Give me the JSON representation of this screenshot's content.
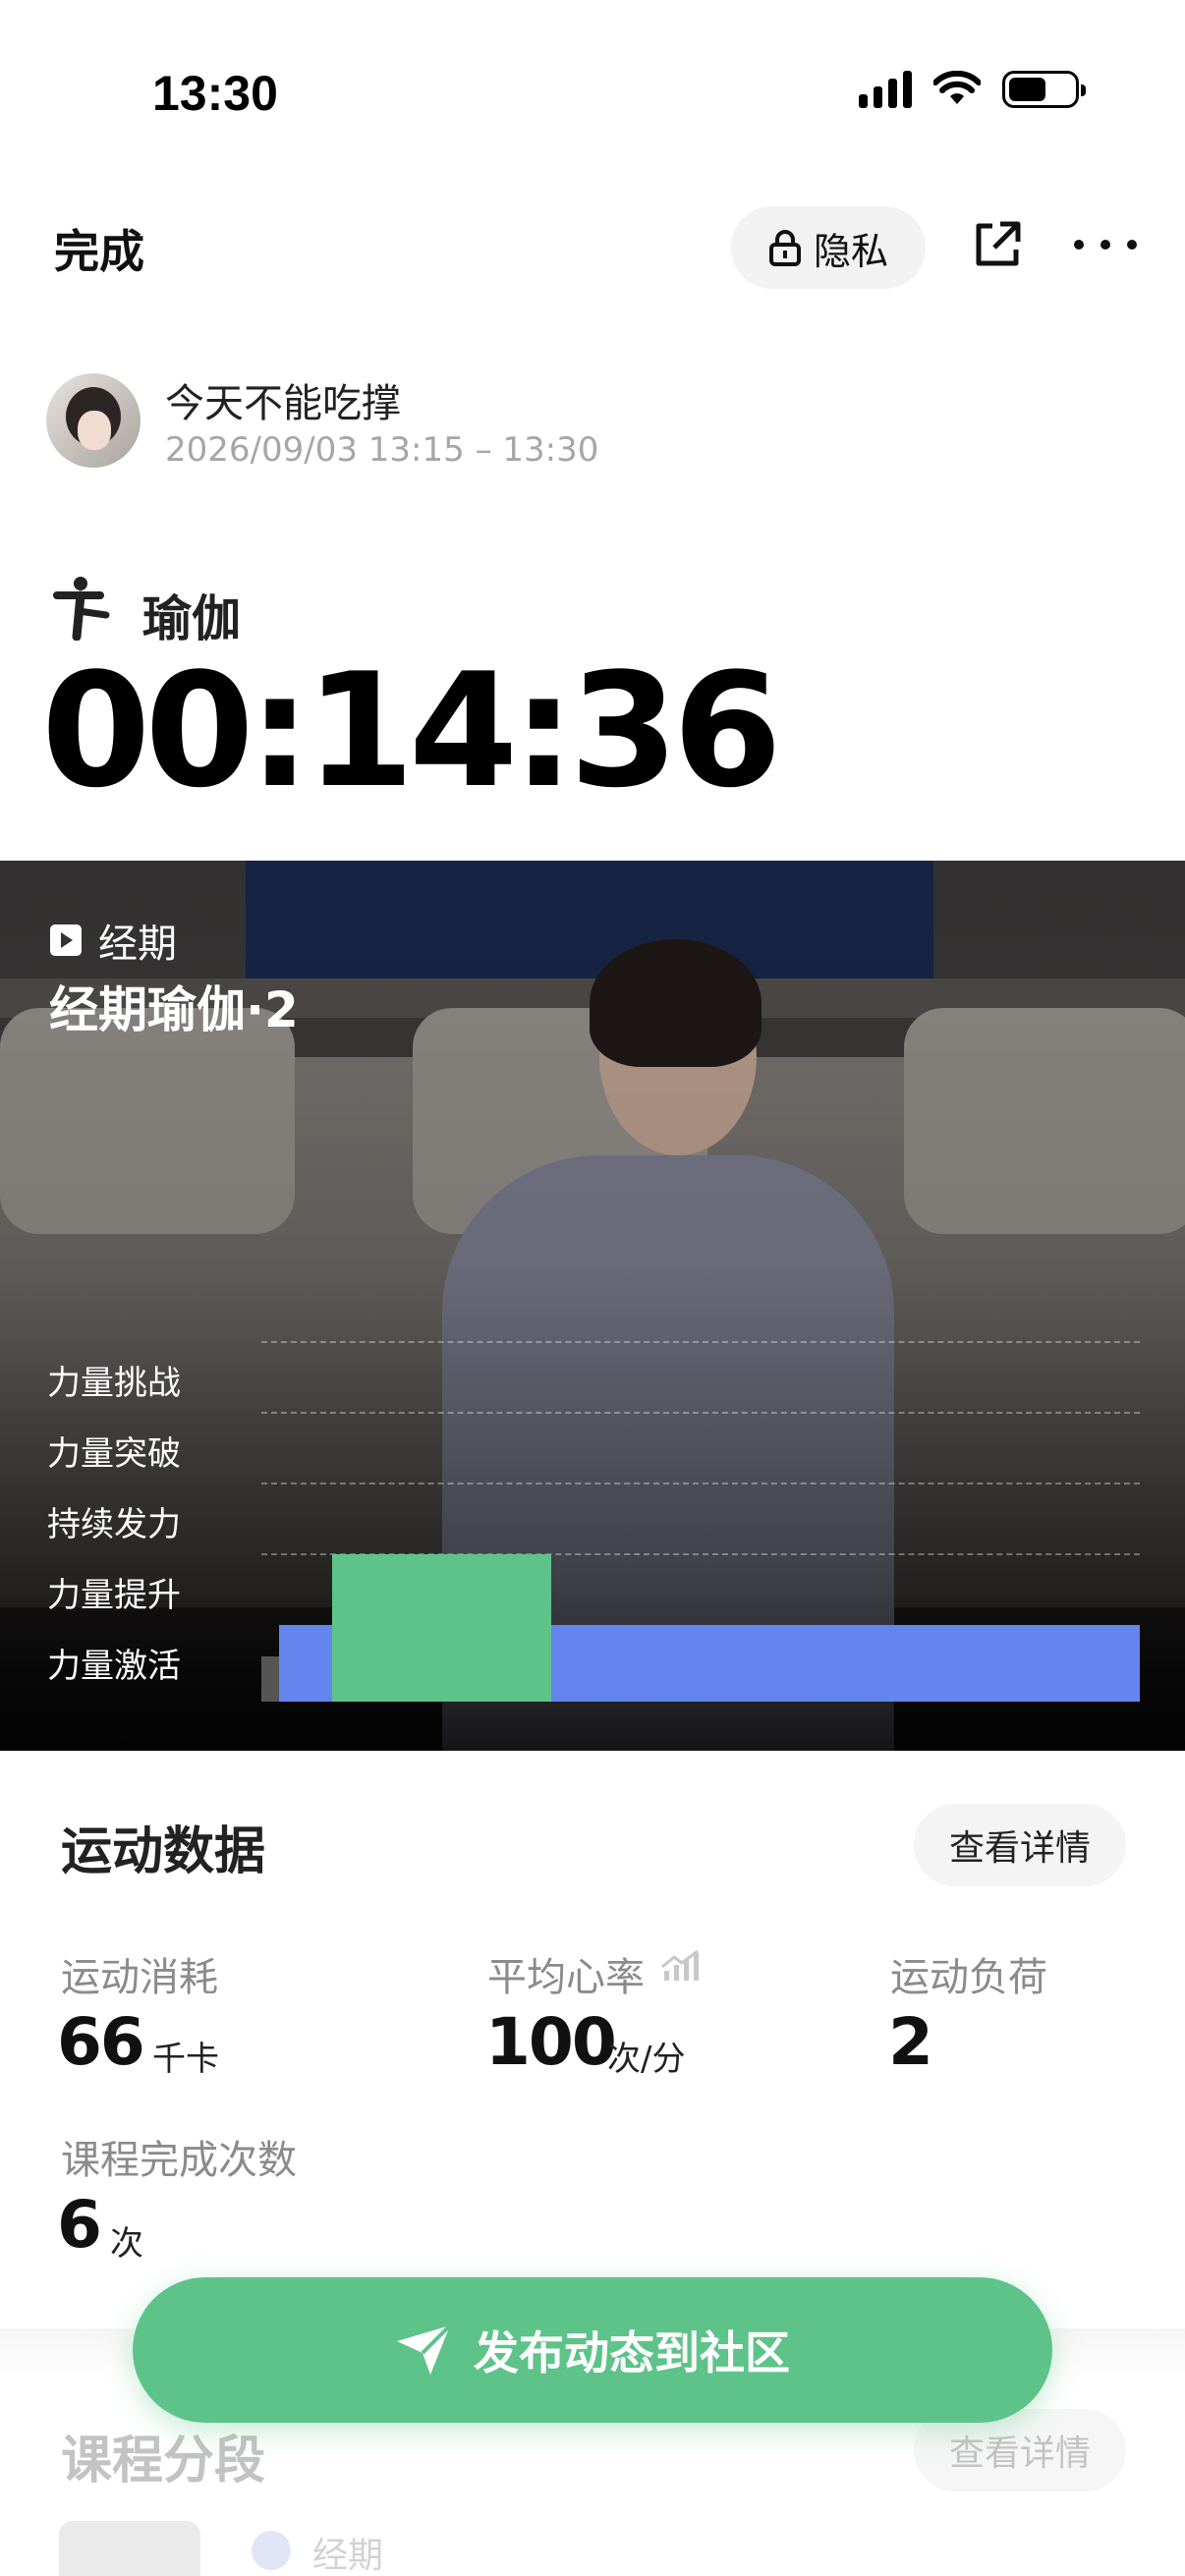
{
  "status_bar": {
    "time": "13:30"
  },
  "header": {
    "done_label": "完成",
    "privacy_label": "隐私"
  },
  "user": {
    "name": "今天不能吃撑",
    "time_range": "2026/09/03 13:15 – 13:30"
  },
  "workout": {
    "type": "瑜伽",
    "duration": "00:14:36"
  },
  "course": {
    "tag": "经期",
    "name": "经期瑜伽·2"
  },
  "intensity_chart": {
    "levels": [
      "力量挑战",
      "力量突破",
      "持续发力",
      "力量提升",
      "力量激活"
    ],
    "segments": [
      {
        "level": "none",
        "start": 0.0,
        "end": 0.02,
        "color": "#555555"
      },
      {
        "level": "力量激活",
        "start": 0.02,
        "end": 1.0,
        "color": "#6585ee"
      },
      {
        "level": "力量提升",
        "start": 0.08,
        "end": 0.33,
        "color": "#5dc389"
      }
    ]
  },
  "stats": {
    "title": "运动数据",
    "detail_label": "查看详情",
    "items": [
      {
        "label": "运动消耗",
        "value": "66",
        "unit": "千卡"
      },
      {
        "label": "平均心率",
        "value": "100",
        "unit": "次/分"
      },
      {
        "label": "运动负荷",
        "value": "2",
        "unit": ""
      },
      {
        "label": "课程完成次数",
        "value": "6",
        "unit": "次"
      }
    ]
  },
  "segments_section": {
    "title": "课程分段",
    "detail_label": "查看详情",
    "first_item_tag": "经期"
  },
  "publish_button": {
    "label": "发布动态到社区"
  }
}
